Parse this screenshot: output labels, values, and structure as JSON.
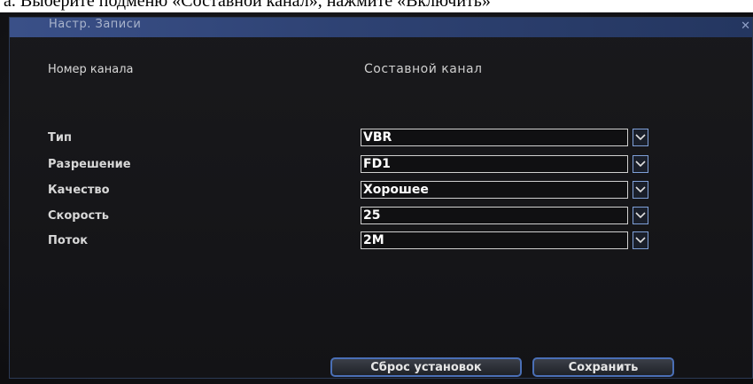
{
  "caption": "а. Выберите подменю «Составной канал», нажмите «Включить»",
  "window": {
    "title": "Настр. Записи",
    "close_icon": "close-icon"
  },
  "channel": {
    "label": "Номер канала",
    "value": "Составной канал"
  },
  "fields": [
    {
      "label": "Тип",
      "value": "VBR"
    },
    {
      "label": "Разрешение",
      "value": "FD1"
    },
    {
      "label": "Качество",
      "value": "Хорошее"
    },
    {
      "label": "Скорость",
      "value": "25"
    },
    {
      "label": "Поток",
      "value": "2M"
    }
  ],
  "buttons": {
    "reset": "Сброс установок",
    "save": "Сохранить"
  },
  "colors": {
    "titlebar": "#3a5088",
    "button_border": "#4a6fb6",
    "dropdown_border": "#7fa0d8"
  }
}
